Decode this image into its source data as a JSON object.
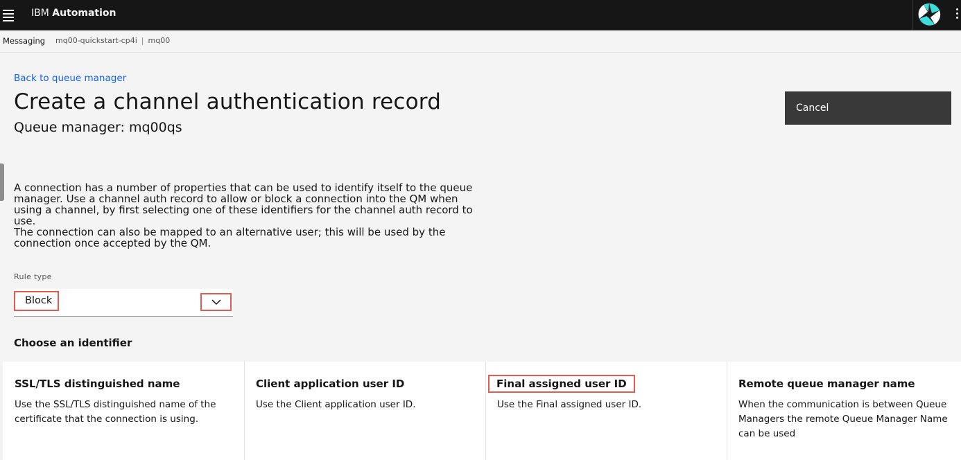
{
  "header": {
    "brand_prefix": "IBM",
    "brand_name": "Automation"
  },
  "breadcrumb": {
    "section": "Messaging",
    "instance": "mq00-quickstart-cp4i",
    "separator": "|",
    "queue_manager": "mq00"
  },
  "page": {
    "back_link": "Back to queue manager",
    "title": "Create a channel authentication record",
    "subtitle": "Queue manager: mq00qs",
    "cancel_label": "Cancel",
    "description_1": "A connection has a number of properties that can be used to identify itself to the queue manager. Use a channel auth record to allow or block a connection into the QM when using a channel, by first selecting one of these identifiers for the channel auth record to use.",
    "description_2": "The connection can also be mapped to an alternative user; this will be used by the connection once accepted by the QM."
  },
  "rule_type": {
    "label": "Rule type",
    "selected": "Block"
  },
  "identifier": {
    "heading": "Choose an identifier",
    "tiles": [
      {
        "title": "SSL/TLS distinguished name",
        "description": "Use the SSL/TLS distinguished name of the certificate that the connection is using."
      },
      {
        "title": "Client application user ID",
        "description": "Use the Client application user ID."
      },
      {
        "title": "Final assigned user ID",
        "description": "Use the Final assigned user ID."
      },
      {
        "title": "Remote queue manager name",
        "description": "When the communication is between Queue Managers the remote Queue Manager Name can be used"
      }
    ]
  },
  "colors": {
    "header_bg": "#161616",
    "link": "#0f62fe",
    "button_bg": "#393939",
    "highlight": "#e35b4f"
  },
  "icons": [
    "menu-icon",
    "avatar-icon",
    "overflow-menu-icon",
    "chevron-down-icon"
  ]
}
